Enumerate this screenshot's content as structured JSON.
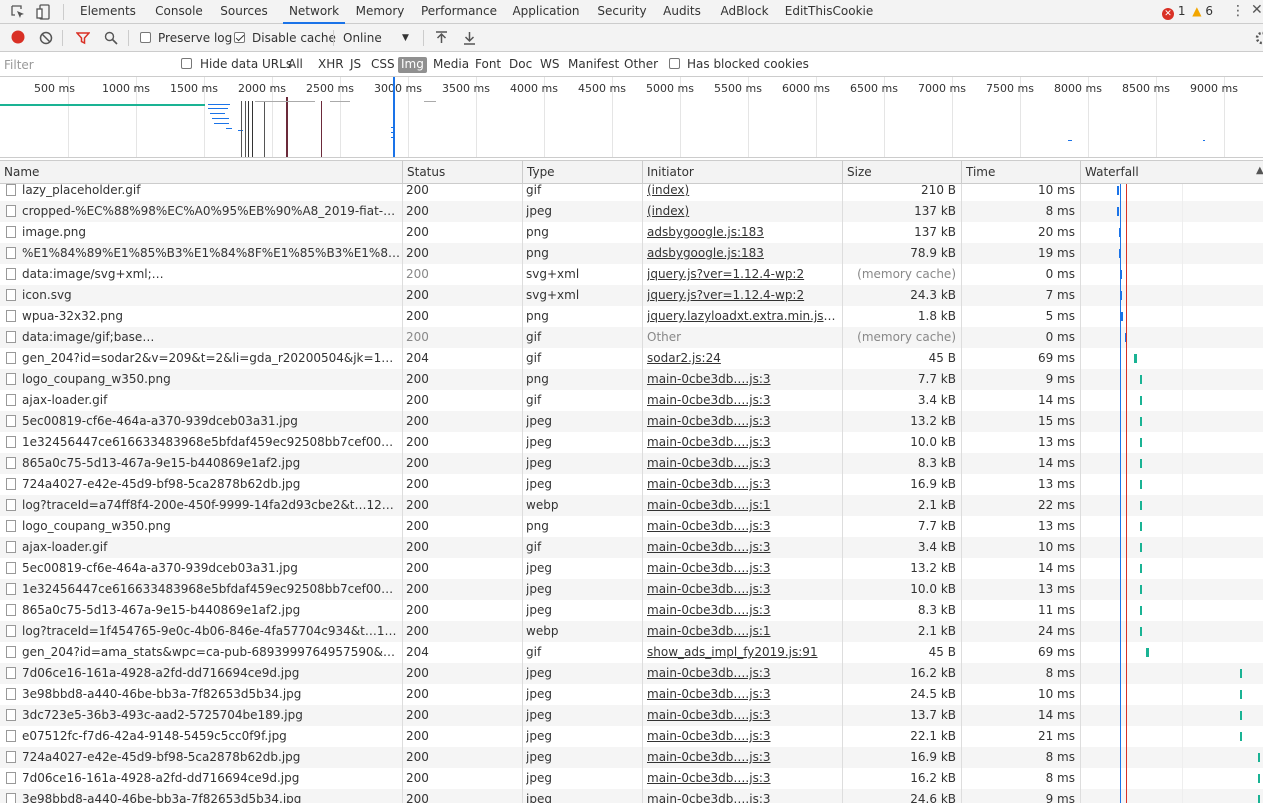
{
  "tabs": [
    "Elements",
    "Console",
    "Sources",
    "Network",
    "Memory",
    "Performance",
    "Application",
    "Security",
    "Audits",
    "AdBlock",
    "EditThisCookie"
  ],
  "active_tab": "Network",
  "error_count": "1",
  "warning_count": "6",
  "toolbar": {
    "preserve_log": "Preserve log",
    "disable_cache": "Disable cache",
    "throttle": "Online"
  },
  "filterbar": {
    "placeholder": "Filter",
    "hide_data_urls": "Hide data URLs",
    "types": [
      "All",
      "XHR",
      "JS",
      "CSS",
      "Img",
      "Media",
      "Font",
      "Doc",
      "WS",
      "Manifest",
      "Other"
    ],
    "active_type": "Img",
    "has_blocked_cookies": "Has blocked cookies"
  },
  "overview_ticks": [
    "500 ms",
    "1000 ms",
    "1500 ms",
    "2000 ms",
    "2500 ms",
    "3000 ms",
    "3500 ms",
    "4000 ms",
    "4500 ms",
    "5000 ms",
    "5500 ms",
    "6000 ms",
    "6500 ms",
    "7000 ms",
    "7500 ms",
    "8000 ms",
    "8500 ms",
    "9000 ms",
    "95"
  ],
  "columns": {
    "name": "Name",
    "status": "Status",
    "type": "Type",
    "initiator": "Initiator",
    "size": "Size",
    "time": "Time",
    "waterfall": "Waterfall"
  },
  "colors": {
    "waterfall_bar": "#1ab394",
    "dom_line": "#1a73e8",
    "load_line": "#d93025"
  },
  "rows": [
    {
      "name": "lazy_placeholder.gif",
      "status": "200",
      "type": "gif",
      "initiator": "(index)",
      "size": "210 B",
      "time": "10 ms",
      "muted": false
    },
    {
      "name": "cropped-%EC%88%98%EC%A0%95%EB%90%A8_2019-fiat-124-abar…",
      "status": "200",
      "type": "jpeg",
      "initiator": "(index)",
      "size": "137 kB",
      "time": "8 ms",
      "muted": false
    },
    {
      "name": "image.png",
      "status": "200",
      "type": "png",
      "initiator": "adsbygoogle.js:183",
      "size": "137 kB",
      "time": "20 ms",
      "muted": false
    },
    {
      "name": "%E1%84%89%E1%85%B3%E1%84%8F%E1%85%B3%E1%84%85%E1…",
      "status": "200",
      "type": "png",
      "initiator": "adsbygoogle.js:183",
      "size": "78.9 kB",
      "time": "19 ms",
      "muted": false
    },
    {
      "name": "data:image/svg+xml;…",
      "status": "200",
      "type": "svg+xml",
      "initiator": "jquery.js?ver=1.12.4-wp:2",
      "size": "(memory cache)",
      "time": "0 ms",
      "muted": true
    },
    {
      "name": "icon.svg",
      "status": "200",
      "type": "svg+xml",
      "initiator": "jquery.js?ver=1.12.4-wp:2",
      "size": "24.3 kB",
      "time": "7 ms",
      "muted": false
    },
    {
      "name": "wpua-32x32.png",
      "status": "200",
      "type": "png",
      "initiator": "jquery.lazyloadxt.extra.min.js?ver=…",
      "size": "1.8 kB",
      "time": "5 ms",
      "muted": false
    },
    {
      "name": "data:image/gif;base…",
      "status": "200",
      "type": "gif",
      "initiator": "Other",
      "size": "(memory cache)",
      "time": "0 ms",
      "muted": true
    },
    {
      "name": "gen_204?id=sodar2&v=209&t=2&li=gda_r20200504&jk=12…f5x05…",
      "status": "204",
      "type": "gif",
      "initiator": "sodar2.js:24",
      "size": "45 B",
      "time": "69 ms",
      "muted": false
    },
    {
      "name": "logo_coupang_w350.png",
      "status": "200",
      "type": "png",
      "initiator": "main-0cbe3db….js:3",
      "size": "7.7 kB",
      "time": "9 ms",
      "muted": false
    },
    {
      "name": "ajax-loader.gif",
      "status": "200",
      "type": "gif",
      "initiator": "main-0cbe3db….js:3",
      "size": "3.4 kB",
      "time": "14 ms",
      "muted": false
    },
    {
      "name": "5ec00819-cf6e-464a-a370-939dceb03a31.jpg",
      "status": "200",
      "type": "jpeg",
      "initiator": "main-0cbe3db….js:3",
      "size": "13.2 kB",
      "time": "15 ms",
      "muted": false
    },
    {
      "name": "1e32456447ce616633483968e5bfdaf459ec92508bb7cef005172743c…",
      "status": "200",
      "type": "jpeg",
      "initiator": "main-0cbe3db….js:3",
      "size": "10.0 kB",
      "time": "13 ms",
      "muted": false
    },
    {
      "name": "865a0c75-5d13-467a-9e15-b440869e1af2.jpg",
      "status": "200",
      "type": "jpeg",
      "initiator": "main-0cbe3db….js:3",
      "size": "8.3 kB",
      "time": "14 ms",
      "muted": false
    },
    {
      "name": "724a4027-e42e-45d9-bf98-5ca2878b62db.jpg",
      "status": "200",
      "type": "jpeg",
      "initiator": "main-0cbe3db….js:3",
      "size": "16.9 kB",
      "time": "13 ms",
      "muted": false
    },
    {
      "name": "log?traceId=a74ff8f4-200e-450f-9999-14fa2d93cbe2&t…12645&rUrl…",
      "status": "200",
      "type": "webp",
      "initiator": "main-0cbe3db….js:1",
      "size": "2.1 kB",
      "time": "22 ms",
      "muted": false
    },
    {
      "name": "logo_coupang_w350.png",
      "status": "200",
      "type": "png",
      "initiator": "main-0cbe3db….js:3",
      "size": "7.7 kB",
      "time": "13 ms",
      "muted": false
    },
    {
      "name": "ajax-loader.gif",
      "status": "200",
      "type": "gif",
      "initiator": "main-0cbe3db….js:3",
      "size": "3.4 kB",
      "time": "10 ms",
      "muted": false
    },
    {
      "name": "5ec00819-cf6e-464a-a370-939dceb03a31.jpg",
      "status": "200",
      "type": "jpeg",
      "initiator": "main-0cbe3db….js:3",
      "size": "13.2 kB",
      "time": "14 ms",
      "muted": false
    },
    {
      "name": "1e32456447ce616633483968e5bfdaf459ec92508bb7cef005172743c…",
      "status": "200",
      "type": "jpeg",
      "initiator": "main-0cbe3db….js:3",
      "size": "10.0 kB",
      "time": "13 ms",
      "muted": false
    },
    {
      "name": "865a0c75-5d13-467a-9e15-b440869e1af2.jpg",
      "status": "200",
      "type": "jpeg",
      "initiator": "main-0cbe3db….js:3",
      "size": "8.3 kB",
      "time": "11 ms",
      "muted": false
    },
    {
      "name": "log?traceId=1f454765-9e0c-4b06-846e-4fa57704c934&t…104048&rU…",
      "status": "200",
      "type": "webp",
      "initiator": "main-0cbe3db….js:1",
      "size": "2.1 kB",
      "time": "24 ms",
      "muted": false
    },
    {
      "name": "gen_204?id=ama_stats&wpc=ca-pub-6893999764957590&s…=8141…",
      "status": "204",
      "type": "gif",
      "initiator": "show_ads_impl_fy2019.js:91",
      "size": "45 B",
      "time": "69 ms",
      "muted": false
    },
    {
      "name": "7d06ce16-161a-4928-a2fd-dd716694ce9d.jpg",
      "status": "200",
      "type": "jpeg",
      "initiator": "main-0cbe3db….js:3",
      "size": "16.2 kB",
      "time": "8 ms",
      "muted": false
    },
    {
      "name": "3e98bbd8-a440-46be-bb3a-7f82653d5b34.jpg",
      "status": "200",
      "type": "jpeg",
      "initiator": "main-0cbe3db….js:3",
      "size": "24.5 kB",
      "time": "10 ms",
      "muted": false
    },
    {
      "name": "3dc723e5-36b3-493c-aad2-5725704be189.jpg",
      "status": "200",
      "type": "jpeg",
      "initiator": "main-0cbe3db….js:3",
      "size": "13.7 kB",
      "time": "14 ms",
      "muted": false
    },
    {
      "name": "e07512fc-f7d6-42a4-9148-5459c5cc0f9f.jpg",
      "status": "200",
      "type": "jpeg",
      "initiator": "main-0cbe3db….js:3",
      "size": "22.1 kB",
      "time": "21 ms",
      "muted": false
    },
    {
      "name": "724a4027-e42e-45d9-bf98-5ca2878b62db.jpg",
      "status": "200",
      "type": "jpeg",
      "initiator": "main-0cbe3db….js:3",
      "size": "16.9 kB",
      "time": "8 ms",
      "muted": false
    },
    {
      "name": "7d06ce16-161a-4928-a2fd-dd716694ce9d.jpg",
      "status": "200",
      "type": "jpeg",
      "initiator": "main-0cbe3db….js:3",
      "size": "16.2 kB",
      "time": "8 ms",
      "muted": false
    },
    {
      "name": "3e98bbd8-a440-46be-bb3a-7f82653d5b34.jpg",
      "status": "200",
      "type": "jpeg",
      "initiator": "main-0cbe3db….js:3",
      "size": "24.6 kB",
      "time": "9 ms",
      "muted": false
    }
  ]
}
